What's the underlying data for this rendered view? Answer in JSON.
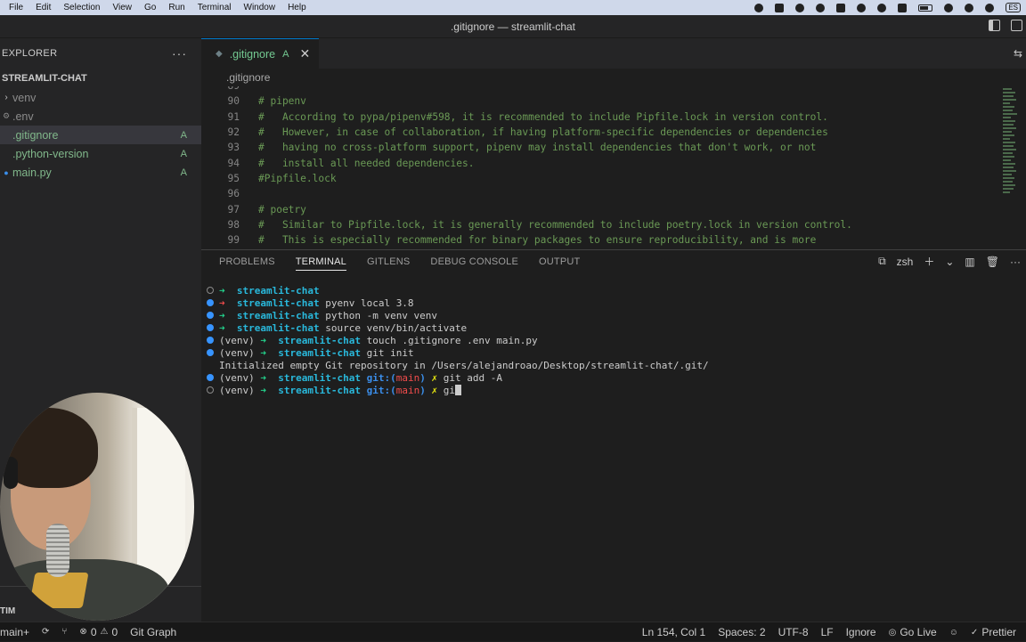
{
  "menubar": {
    "items": [
      "File",
      "Edit",
      "Selection",
      "View",
      "Go",
      "Run",
      "Terminal",
      "Window",
      "Help"
    ],
    "language": "ES"
  },
  "window": {
    "title": ".gitignore — streamlit-chat"
  },
  "sidebar": {
    "header": "EXPLORER",
    "folder": "STREAMLIT-CHAT",
    "items": [
      {
        "label": "venv",
        "badge": ""
      },
      {
        "label": ".env",
        "badge": ""
      },
      {
        "label": ".gitignore",
        "badge": "A"
      },
      {
        "label": ".python-version",
        "badge": "A"
      },
      {
        "label": "main.py",
        "badge": "A"
      }
    ],
    "footer": "TIM"
  },
  "editor": {
    "tab": {
      "label": ".gitignore",
      "badge": "A"
    },
    "breadcrumb": ".gitignore",
    "lines": [
      {
        "n": "89",
        "text": ""
      },
      {
        "n": "90",
        "text": "# pipenv"
      },
      {
        "n": "91",
        "text": "#   According to pypa/pipenv#598, it is recommended to include Pipfile.lock in version control."
      },
      {
        "n": "92",
        "text": "#   However, in case of collaboration, if having platform-specific dependencies or dependencies"
      },
      {
        "n": "93",
        "text": "#   having no cross-platform support, pipenv may install dependencies that don't work, or not"
      },
      {
        "n": "94",
        "text": "#   install all needed dependencies."
      },
      {
        "n": "95",
        "text": "#Pipfile.lock"
      },
      {
        "n": "96",
        "text": ""
      },
      {
        "n": "97",
        "text": "# poetry"
      },
      {
        "n": "98",
        "text": "#   Similar to Pipfile.lock, it is generally recommended to include poetry.lock in version control."
      },
      {
        "n": "99",
        "text": "#   This is especially recommended for binary packages to ensure reproducibility, and is more"
      }
    ]
  },
  "panel": {
    "tabs": [
      "PROBLEMS",
      "TERMINAL",
      "GITLENS",
      "DEBUG CONSOLE",
      "OUTPUT"
    ],
    "shell": "zsh",
    "terminal": {
      "dir": "streamlit-chat",
      "venv": "(venv)",
      "git_label": "git:(",
      "branch": "main",
      "git_close": ")",
      "lines": [
        {
          "cmd": ""
        },
        {
          "cmd": "pyenv local 3.8"
        },
        {
          "cmd": "python -m venv venv"
        },
        {
          "cmd": "source venv/bin/activate"
        },
        {
          "cmd": "touch .gitignore .env main.py"
        },
        {
          "cmd": "git init"
        },
        {
          "output": "Initialized empty Git repository in /Users/alejandroao/Desktop/streamlit-chat/.git/"
        },
        {
          "cmd": "git add -A"
        },
        {
          "cmd": "gi"
        }
      ]
    }
  },
  "statusbar": {
    "branch": "main+",
    "errors": "0",
    "warnings": "0",
    "git_graph": "Git Graph",
    "position": "Ln 154, Col 1",
    "spaces": "Spaces: 2",
    "encoding": "UTF-8",
    "eol": "LF",
    "language": "Ignore",
    "go_live": "Go Live",
    "prettier": "Prettier"
  }
}
